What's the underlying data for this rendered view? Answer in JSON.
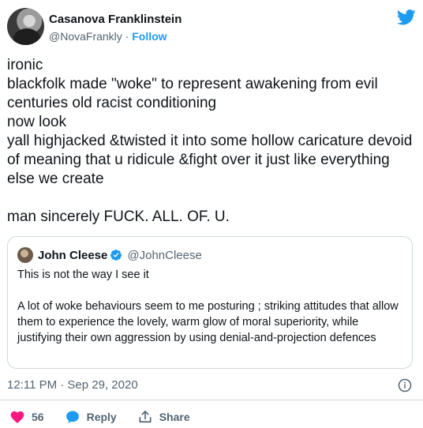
{
  "header": {
    "display_name": "Casanova Franklinstein",
    "handle": "@NovaFrankly",
    "separator": "·",
    "follow_label": "Follow"
  },
  "tweet": {
    "text": "ironic\nblackfolk made \"woke\" to represent awakening from evil centuries old racist conditioning\nnow look\nyall highjacked &twisted it into some hollow caricature devoid of meaning that u ridicule &fight over it just like everything else we create\n\nman sincerely FUCK. ALL. OF. U."
  },
  "quote": {
    "name": "John Cleese",
    "handle": "@JohnCleese",
    "text": "This is not the way I see it\n\nA lot of woke behaviours seem to me posturing ; striking attitudes that allow them to experience the lovely, warm glow of moral superiority, while justifying their own aggression by using denial-and-projection defences"
  },
  "meta": {
    "timestamp": "12:11 PM · Sep 29, 2020"
  },
  "actions": {
    "like_count": "56",
    "reply_label": "Reply",
    "share_label": "Share"
  },
  "colors": {
    "accent": "#1d9bf0",
    "like": "#f91880",
    "muted": "#536471",
    "border": "#cfd9de"
  }
}
